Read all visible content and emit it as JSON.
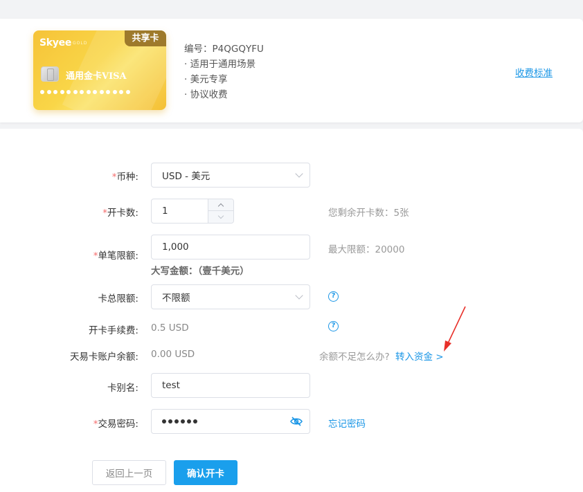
{
  "card": {
    "brand": "Skyee",
    "gold_text": "GOLD",
    "tag": "共享卡",
    "title": "通用金卡VISA",
    "info": {
      "number": "编号：P4QGQYFU",
      "scene": "· 适用于通用场景",
      "currency_only": "· 美元专享",
      "fee_policy": "· 协议收费"
    },
    "fee_link": "收费标准"
  },
  "form": {
    "currency": {
      "label": "币种:",
      "value": "USD - 美元"
    },
    "card_count": {
      "label": "开卡数:",
      "value": "1",
      "hint": "您剩余开卡数：5张"
    },
    "single_limit": {
      "label": "单笔限额:",
      "value": "1,000",
      "uppercase_amount": "大写金额：（壹千美元）",
      "hint": "最大限额：20000"
    },
    "total_limit": {
      "label": "卡总限额:",
      "value": "不限额"
    },
    "fee": {
      "label": "开卡手续费:",
      "value": "0.5 USD"
    },
    "balance": {
      "label": "天易卡账户余额:",
      "value": "0.00 USD",
      "hint": "余额不足怎么办?",
      "transfer_link": "转入资金 >"
    },
    "alias": {
      "label": "卡别名:",
      "value": "test"
    },
    "password": {
      "label": "交易密码:",
      "forgot_link": "忘记密码"
    }
  },
  "buttons": {
    "back": "返回上一页",
    "confirm": "确认开卡"
  },
  "colors": {
    "accent": "#1a96e6",
    "required": "#f56c6c",
    "card_gold": "#f6c338",
    "annotation_arrow": "#e8302a"
  }
}
